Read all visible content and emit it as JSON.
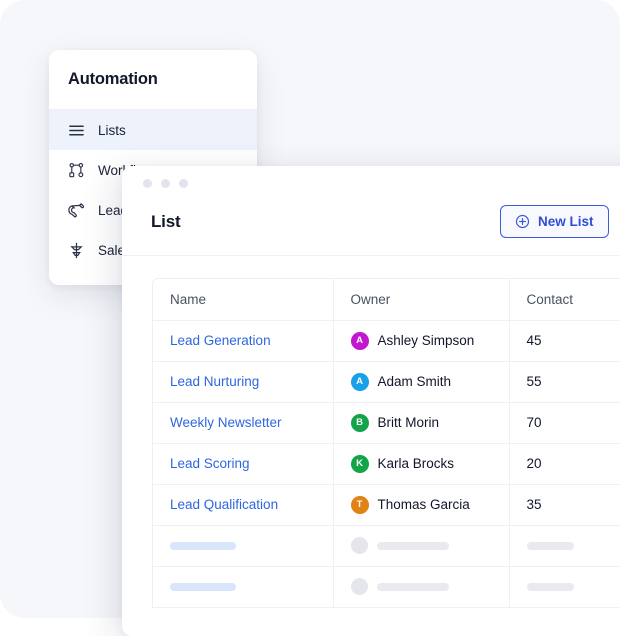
{
  "theme": {
    "backdrop": "#f6f7fa",
    "card_bg": "#ffffff",
    "accent": "#3b5bdb",
    "link": "#2f66e0",
    "active_row": "#eef2fb",
    "border": "#eef0f5",
    "text": "#11162a"
  },
  "sidebar": {
    "title": "Automation",
    "items": [
      {
        "label": "Lists",
        "icon": "list-lines-icon",
        "active": true
      },
      {
        "label": "Workflows",
        "icon": "workflow-nodes-icon",
        "active": false
      },
      {
        "label": "Lead Magnet",
        "icon": "magnet-icon",
        "active": false
      },
      {
        "label": "Sales Funnel",
        "icon": "funnel-icon",
        "active": false
      }
    ]
  },
  "window": {
    "dots": [
      "dot-1",
      "dot-2",
      "dot-3"
    ]
  },
  "main": {
    "title": "List",
    "new_list_label": "New List",
    "plus_icon": "plus-circle-icon"
  },
  "table": {
    "columns": [
      "Name",
      "Owner",
      "Contact"
    ],
    "rows": [
      {
        "name": "Lead Generation",
        "owner": "Ashley Simpson",
        "initial": "A",
        "avatar_color": "#c118cf",
        "contact": "45"
      },
      {
        "name": "Lead Nurturing",
        "owner": "Adam Smith",
        "initial": "A",
        "avatar_color": "#18a0e8",
        "contact": "55"
      },
      {
        "name": "Weekly Newsletter",
        "owner": "Britt Morin",
        "initial": "B",
        "avatar_color": "#13a349",
        "contact": "70"
      },
      {
        "name": "Lead Scoring",
        "owner": "Karla Brocks",
        "initial": "K",
        "avatar_color": "#13a349",
        "contact": "20"
      },
      {
        "name": "Lead Qualification",
        "owner": "Thomas Garcia",
        "initial": "T",
        "avatar_color": "#e08214",
        "contact": "35"
      }
    ],
    "skeleton_rows": 2
  }
}
